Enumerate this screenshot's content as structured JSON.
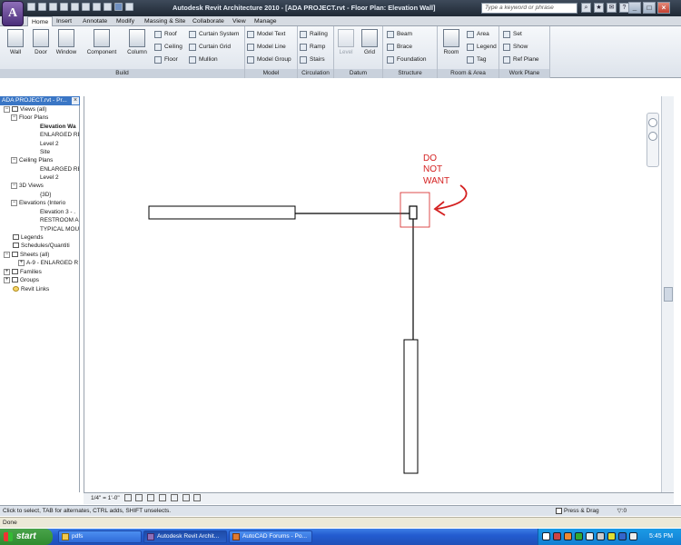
{
  "window": {
    "title": "Autodesk Revit Architecture 2010 - [ADA PROJECT.rvt - Floor Plan: Elevation Wall]",
    "app_button": "A",
    "search_placeholder": "Type a keyword or phrase",
    "minimize": "_",
    "maximize": "□",
    "close": "×"
  },
  "ribbon_tabs": [
    "Home",
    "Insert",
    "Annotate",
    "Modify",
    "Massing & Site",
    "Collaborate",
    "View",
    "Manage"
  ],
  "panels": {
    "build": {
      "title": "Build",
      "wall": "Wall",
      "door": "Door",
      "window": "Window",
      "component": "Component",
      "column": "Column",
      "roof": "Roof",
      "ceiling": "Ceiling",
      "floor": "Floor",
      "curtain_system": "Curtain System",
      "curtain_grid": "Curtain Grid",
      "mullion": "Mullion"
    },
    "model": {
      "title": "Model",
      "model_text": "Model Text",
      "model_line": "Model Line",
      "model_group": "Model Group"
    },
    "circulation": {
      "title": "Circulation",
      "railing": "Railing",
      "ramp": "Ramp",
      "stairs": "Stairs"
    },
    "datum": {
      "title": "Datum",
      "level": "Level",
      "grid": "Grid"
    },
    "structure": {
      "title": "Structure",
      "beam": "Beam",
      "brace": "Brace",
      "foundation": "Foundation"
    },
    "room_area": {
      "title": "Room & Area",
      "room": "Room",
      "area": "Area",
      "legend": "Legend",
      "tag": "Tag"
    },
    "work_plane": {
      "title": "Work Plane",
      "set": "Set",
      "show": "Show",
      "ref_plane": "Ref Plane"
    }
  },
  "project_browser": {
    "title": "ADA PROJECT.rvt - Pr...",
    "close": "×",
    "items": [
      {
        "label": "Views (all)",
        "expander": "−"
      },
      {
        "label": "Floor Plans",
        "expander": "−"
      },
      {
        "label": "Elevation Wa"
      },
      {
        "label": "ENLARGED RE"
      },
      {
        "label": "Level 2"
      },
      {
        "label": "Site"
      },
      {
        "label": "Ceiling Plans",
        "expander": "−"
      },
      {
        "label": "ENLARGED RE"
      },
      {
        "label": "Level 2"
      },
      {
        "label": "3D Views",
        "expander": "−"
      },
      {
        "label": "{3D}"
      },
      {
        "label": "Elevations (Interio",
        "expander": "−"
      },
      {
        "label": "Elevation 3 - ."
      },
      {
        "label": "RESTROOM AC"
      },
      {
        "label": "TYPICAL MOUN"
      },
      {
        "label": "Legends"
      },
      {
        "label": "Schedules/Quantiti"
      },
      {
        "label": "Sheets (all)",
        "expander": "−"
      },
      {
        "label": "A-9 - ENLARGED R",
        "expander": "+"
      },
      {
        "label": "Families",
        "expander": "+"
      },
      {
        "label": "Groups",
        "expander": "+"
      },
      {
        "label": "Revit Links"
      }
    ]
  },
  "canvas": {
    "annotation_line1": "DO",
    "annotation_line2": "NOT",
    "annotation_line3": "WANT",
    "annotation_color": "#d42020"
  },
  "view_control": {
    "scale": "1/4\" = 1'-0\""
  },
  "status": {
    "message": "Click to select, TAB for alternates, CTRL adds, SHIFT unselects.",
    "press_drag": "Press & Drag",
    "filter_count": ":0",
    "ie_status": "Done"
  },
  "taskbar": {
    "start": "start",
    "tasks": [
      "pdfs",
      "Autodesk Revit Archit...",
      "AutoCAD Forums - Po..."
    ],
    "clock": "5:45 PM"
  }
}
